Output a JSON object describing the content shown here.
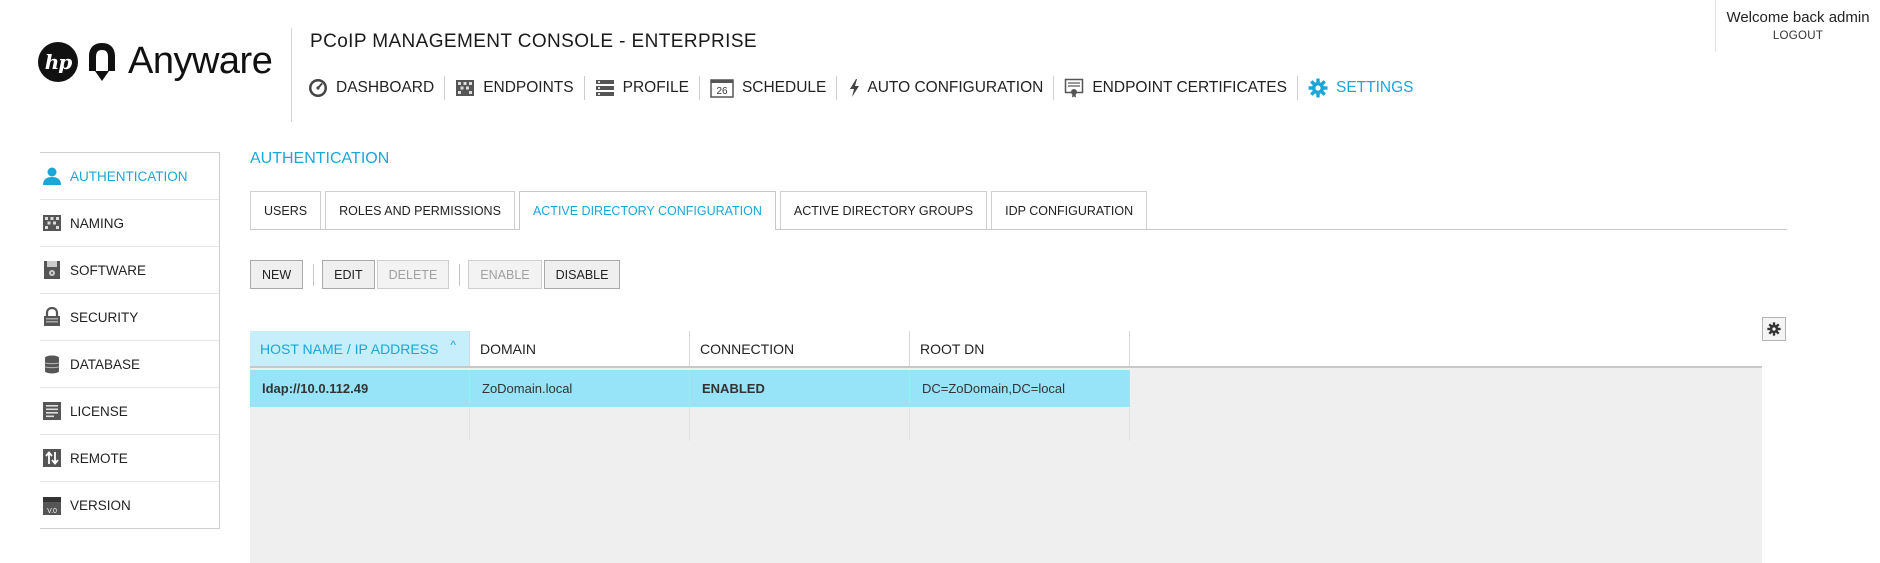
{
  "brand": {
    "hp_mark": "hp",
    "name": "Anyware"
  },
  "console_title": "PCoIP MANAGEMENT CONSOLE - ENTERPRISE",
  "user": {
    "welcome": "Welcome back admin",
    "logout": "LOGOUT"
  },
  "top_nav": [
    {
      "label": "DASHBOARD",
      "icon": "dashboard-icon",
      "active": false
    },
    {
      "label": "ENDPOINTS",
      "icon": "endpoints-icon",
      "active": false
    },
    {
      "label": "PROFILE",
      "icon": "profile-icon",
      "active": false
    },
    {
      "label": "SCHEDULE",
      "icon": "calendar-icon",
      "active": false,
      "icon_text": "26"
    },
    {
      "label": "AUTO CONFIGURATION",
      "icon": "lightning-icon",
      "active": false
    },
    {
      "label": "ENDPOINT CERTIFICATES",
      "icon": "certificate-icon",
      "active": false
    },
    {
      "label": "SETTINGS",
      "icon": "gear-icon",
      "active": true
    }
  ],
  "sidebar": {
    "items": [
      {
        "label": "AUTHENTICATION",
        "icon": "user-icon",
        "active": true
      },
      {
        "label": "NAMING",
        "icon": "naming-icon",
        "active": false
      },
      {
        "label": "SOFTWARE",
        "icon": "software-icon",
        "active": false
      },
      {
        "label": "SECURITY",
        "icon": "lock-icon",
        "active": false
      },
      {
        "label": "DATABASE",
        "icon": "database-icon",
        "active": false
      },
      {
        "label": "LICENSE",
        "icon": "license-icon",
        "active": false
      },
      {
        "label": "REMOTE",
        "icon": "remote-icon",
        "active": false
      },
      {
        "label": "VERSION",
        "icon": "version-icon",
        "active": false,
        "icon_text": "V.0"
      }
    ]
  },
  "main": {
    "section_title": "AUTHENTICATION",
    "tabs": [
      {
        "label": "USERS",
        "active": false
      },
      {
        "label": "ROLES AND PERMISSIONS",
        "active": false
      },
      {
        "label": "ACTIVE DIRECTORY CONFIGURATION",
        "active": true
      },
      {
        "label": "ACTIVE DIRECTORY GROUPS",
        "active": false
      },
      {
        "label": "IDP CONFIGURATION",
        "active": false
      }
    ],
    "toolbar": {
      "new": "NEW",
      "edit": "EDIT",
      "delete": "DELETE",
      "enable": "ENABLE",
      "disable": "DISABLE"
    },
    "table": {
      "columns": [
        "HOST NAME / IP ADDRESS",
        "DOMAIN",
        "CONNECTION",
        "ROOT DN"
      ],
      "sort_indicator": "^",
      "rows": [
        [
          "ldap://10.0.112.49",
          "ZoDomain.local",
          "ENABLED",
          "DC=ZoDomain,DC=local"
        ]
      ]
    }
  },
  "colors": {
    "accent": "#1ba6d6",
    "selected_row": "#97e3f7",
    "sorted_header": "#c6eefb"
  }
}
